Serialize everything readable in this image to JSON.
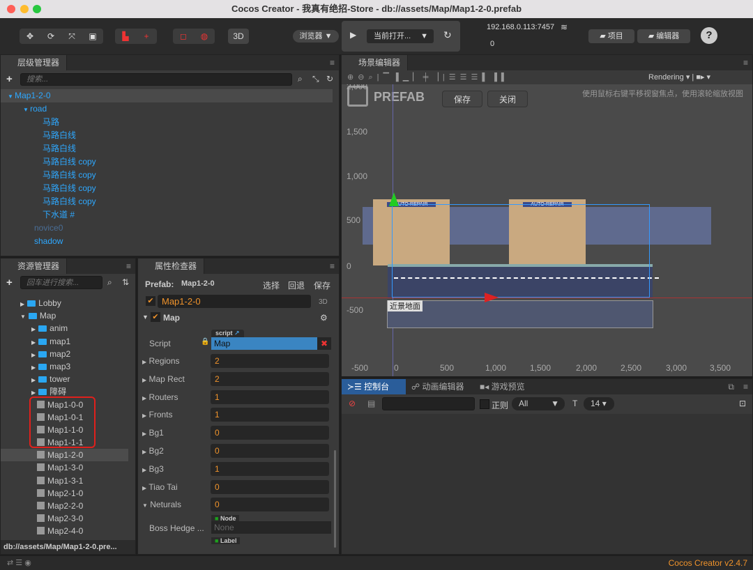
{
  "window": {
    "title": "Cocos Creator - 我真有绝招-Store - db://assets/Map/Map1-2-0.prefab"
  },
  "toolbar": {
    "btn_3d": "3D",
    "browser": "浏览器 ▼",
    "play_icon": "play-icon",
    "open_scene": "当前打开...",
    "ip": "192.168.0.113:7457",
    "count": "0",
    "project": "项目",
    "editor": "编辑器",
    "help": "?"
  },
  "hierarchy": {
    "title": "层级管理器",
    "search_placeholder": "搜索...",
    "items": [
      {
        "label": "Map1-2-0",
        "depth": 0,
        "expanded": true,
        "selected": true
      },
      {
        "label": "road",
        "depth": 1,
        "expanded": true
      },
      {
        "label": "马路",
        "depth": 2
      },
      {
        "label": "马路白线",
        "depth": 2
      },
      {
        "label": "马路白线",
        "depth": 2
      },
      {
        "label": "马路白线 copy",
        "depth": 2
      },
      {
        "label": "马路白线 copy",
        "depth": 2
      },
      {
        "label": "马路白线 copy",
        "depth": 2
      },
      {
        "label": "马路白线 copy",
        "depth": 2
      },
      {
        "label": "下水道 #",
        "depth": 2
      },
      {
        "label": "novice0",
        "depth": 1,
        "dim": true
      },
      {
        "label": "shadow",
        "depth": 1
      }
    ]
  },
  "assets": {
    "title": "资源管理器",
    "search_placeholder": "回车进行搜索...",
    "items": [
      {
        "label": "Lobby",
        "type": "folder",
        "depth": 1
      },
      {
        "label": "Map",
        "type": "folder",
        "depth": 1,
        "expanded": true
      },
      {
        "label": "anim",
        "type": "folder",
        "depth": 2
      },
      {
        "label": "map1",
        "type": "folder",
        "depth": 2
      },
      {
        "label": "map2",
        "type": "folder",
        "depth": 2
      },
      {
        "label": "map3",
        "type": "folder",
        "depth": 2
      },
      {
        "label": "tower",
        "type": "folder",
        "depth": 2
      },
      {
        "label": "障碍",
        "type": "folder",
        "depth": 2
      },
      {
        "label": "Map1-0-0",
        "type": "prefab",
        "highlight": true
      },
      {
        "label": "Map1-0-1",
        "type": "prefab",
        "highlight": true
      },
      {
        "label": "Map1-1-0",
        "type": "prefab",
        "highlight": true
      },
      {
        "label": "Map1-1-1",
        "type": "prefab",
        "highlight": true
      },
      {
        "label": "Map1-2-0",
        "type": "prefab",
        "selected": true
      },
      {
        "label": "Map1-3-0",
        "type": "prefab"
      },
      {
        "label": "Map1-3-1",
        "type": "prefab"
      },
      {
        "label": "Map2-1-0",
        "type": "prefab"
      },
      {
        "label": "Map2-2-0",
        "type": "prefab"
      },
      {
        "label": "Map2-3-0",
        "type": "prefab"
      },
      {
        "label": "Map2-4-0",
        "type": "prefab"
      }
    ],
    "path": "db://assets/Map/Map1-2-0.pre..."
  },
  "inspector": {
    "title": "属性检查器",
    "prefab_label": "Prefab:",
    "prefab_name": "Map1-2-0",
    "select": "选择",
    "revert": "回退",
    "save": "保存",
    "node_name": "Map1-2-0",
    "tag_3d": "3D",
    "component": "Map",
    "script_label": "Script",
    "script_tag": "script",
    "script_value": "Map",
    "props": [
      {
        "label": "Regions",
        "value": "2"
      },
      {
        "label": "Map Rect",
        "value": "2"
      },
      {
        "label": "Routers",
        "value": "1"
      },
      {
        "label": "Fronts",
        "value": "1"
      },
      {
        "label": "Bg1",
        "value": "0"
      },
      {
        "label": "Bg2",
        "value": "0"
      },
      {
        "label": "Bg3",
        "value": "1"
      },
      {
        "label": "Tiao Tai",
        "value": "0"
      },
      {
        "label": "Neturals",
        "value": "0",
        "expanded": true
      }
    ],
    "boss_label": "Boss Hedge ...",
    "node_tag": "Node",
    "boss_value": "None",
    "label_tag": "Label"
  },
  "scene": {
    "title": "场景编辑器",
    "prefab": "PREFAB",
    "save": "保存",
    "close": "关闭",
    "hint": "使用鼠标右键平移视窗焦点，使用滚轮缩放视图",
    "rendering": "Rendering",
    "y_ticks": [
      "2,000",
      "1,500",
      "1,000",
      "500",
      "0",
      "-500"
    ],
    "x_ticks": [
      "-500",
      "0",
      "500",
      "1,000",
      "1,500",
      "2,000",
      "2,500",
      "3,000",
      "3,500"
    ],
    "node_label": "近景地面",
    "sign": "AUTO-REPAIR"
  },
  "console": {
    "tabs": [
      "控制台",
      "动画编辑器",
      "游戏预览"
    ],
    "regex": "正则",
    "level": "All",
    "font_size": "14"
  },
  "status": {
    "version": "Cocos Creator v2.4.7"
  },
  "colors": {
    "accent": "#2ea8ff",
    "orange": "#f0932b",
    "selected_tab": "#2a5d9a"
  }
}
